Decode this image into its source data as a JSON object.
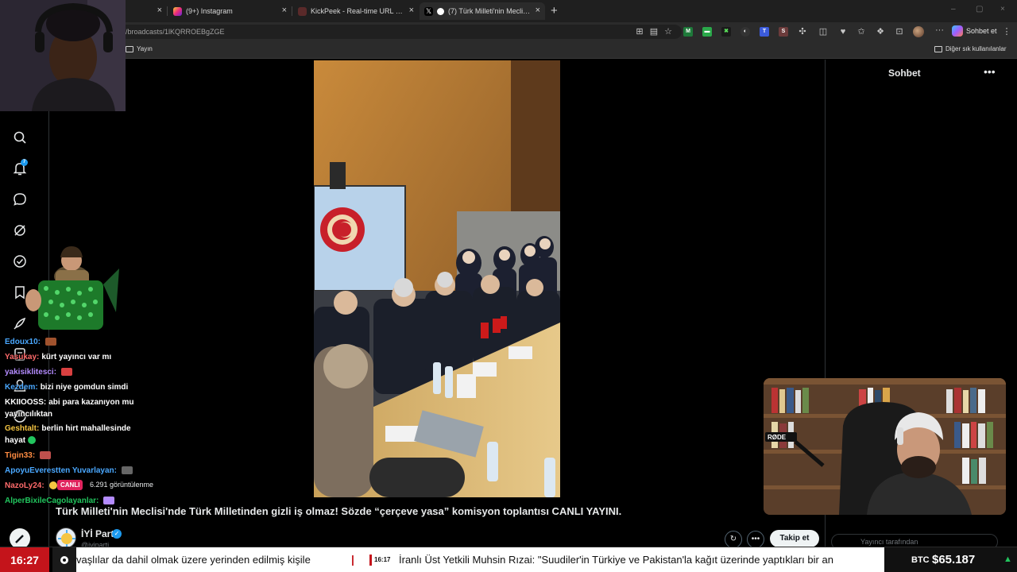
{
  "browser": {
    "tabs": [
      {
        "label": "",
        "close": "×"
      },
      {
        "label": "(9+) Instagram",
        "close": "×"
      },
      {
        "label": "KickPeek - Real-time URL Crawler f",
        "close": "×"
      },
      {
        "label": "(7) Türk Milleti'nin Meclisi'nde",
        "close": "×"
      }
    ],
    "new_tab": "+",
    "url": "/broadcasts/1lKQRROEBgZGE",
    "copilot_label": "Sohbet et",
    "bookmarks": {
      "left": "Yayın",
      "right": "Diğer sık kullanılanlar"
    },
    "window_controls": [
      "–",
      "▢",
      "×"
    ]
  },
  "sidebar": {
    "notification_count": "7"
  },
  "chat_panel": {
    "title": "Sohbet",
    "more": "•••",
    "input_placeholder": "Yayıncı tarafından"
  },
  "stream": {
    "title": "Türk Milleti'nin Meclisi'nde Türk Milletinden gizli iş olmaz! Sözde “çerçeve yasa” komisyon toplantısı CANLI YAYINI.",
    "author_name": "İYİ Parti",
    "author_handle": "@iyiparti",
    "live_label": "CANLI",
    "views": "6.291 görüntülenme",
    "follow_label": "Takip et",
    "more_icon": "•••"
  },
  "overlay_chat": [
    {
      "user": "Edoux10:",
      "text": "",
      "user_color": "#4aa8ff",
      "emote_color": "#a0522d"
    },
    {
      "user": "Yasukay:",
      "text": "kürt yayıncı var mı",
      "user_color": "#ff6b6b",
      "emote_color": ""
    },
    {
      "user": "yakisiklitesci:",
      "text": "",
      "user_color": "#b48cff",
      "emote_color": "#d94040"
    },
    {
      "user": "Kezdem:",
      "text": "bizi niye gomdun simdi",
      "user_color": "#4aa8ff",
      "emote_color": ""
    },
    {
      "user": "KKIIOOSS:",
      "text": "abi para kazanıyon mu",
      "user_color": "#ffffff",
      "emote_color": ""
    },
    {
      "user": "",
      "text": "yayıncılıktan",
      "user_color": "#ffffff",
      "emote_color": ""
    },
    {
      "user": "Geshtalt:",
      "text": "berlin hirt mahallesinde",
      "user_color": "#f5c542",
      "emote_color": ""
    },
    {
      "user": "",
      "text": "hayat",
      "user_color": "#ffffff",
      "emote_color": "#22c55e"
    },
    {
      "user": "Tigin33:",
      "text": "",
      "user_color": "#ff8c42",
      "emote_color": "#c0504d"
    },
    {
      "user": "ApoyuEverestten Yuvarlayan:",
      "text": "",
      "user_color": "#4aa8ff",
      "emote_color": "#666666"
    },
    {
      "user": "NazoLy24:",
      "text": "",
      "user_color": "#ff6b6b",
      "emote_color": "#f5c542"
    },
    {
      "user": "AlperBixileCagolayanlar:",
      "text": "",
      "user_color": "#22c55e",
      "emote_color": "#b48cff"
    }
  ],
  "ticker": {
    "clock": "16:27",
    "headline_1": "vaşlılar da dahil olmak üzere yerinden edilmiş kişile",
    "separator": "|",
    "time_tag": "16:17",
    "headline_2": "İranlı Üst Yetkili Muhsin Rızai: \"Suudiler'in Türkiye ve Pakistan'la kağıt üzerinde yaptıkları bir an",
    "btc_label": "BTC",
    "btc_value": "$65.187",
    "btc_trend": "▲"
  },
  "colors": {
    "accent": "#1d9bf0",
    "live": "#e0245e",
    "ticker_red": "#c4141b",
    "btc_up": "#22c55e"
  }
}
